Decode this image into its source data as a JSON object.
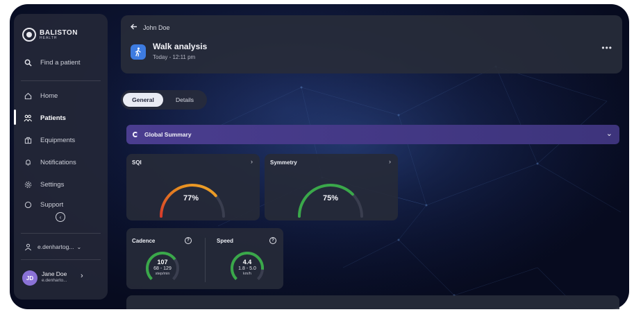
{
  "brand": {
    "name": "BALISTON",
    "sub": "HEALTH"
  },
  "sidebar": {
    "search": "Find a patient",
    "items": [
      {
        "label": "Home",
        "icon": "home-icon"
      },
      {
        "label": "Patients",
        "icon": "patients-icon",
        "active": true
      },
      {
        "label": "Equipments",
        "icon": "equipment-icon"
      },
      {
        "label": "Notifications",
        "icon": "bell-icon"
      },
      {
        "label": "Settings",
        "icon": "gear-icon"
      },
      {
        "label": "Support",
        "icon": "help-icon"
      }
    ],
    "account": "e.denhartog...",
    "user": {
      "initials": "JD",
      "name": "Jane Doe",
      "email": "e.denharto..."
    }
  },
  "header": {
    "back_label": "John Doe",
    "title": "Walk analysis",
    "subtitle": "Today - 12:11 pm",
    "more": "•••"
  },
  "tabs": {
    "general": "General",
    "details": "Details"
  },
  "summary": {
    "title": "Global Summary"
  },
  "cards": {
    "sqi": {
      "label": "SQI",
      "value": "77%",
      "fraction": 0.77
    },
    "symmetry": {
      "label": "Symmetry",
      "value": "75%",
      "fraction": 0.75
    },
    "cadence": {
      "label": "Cadence",
      "value": "107",
      "range": "68 - 129",
      "unit": "step/min",
      "fraction": 0.7
    },
    "speed": {
      "label": "Speed",
      "value": "4.4",
      "range": "1.8 - 5.0",
      "unit": "km/h",
      "fraction": 0.85
    }
  },
  "colors": {
    "accent": "#3d7be0",
    "summary": "#4a3d8f",
    "gauge_green": "#3aa84a",
    "gauge_orange": "#e58a1f",
    "gauge_red": "#d83a2a",
    "avatar": "#8a72d6"
  }
}
